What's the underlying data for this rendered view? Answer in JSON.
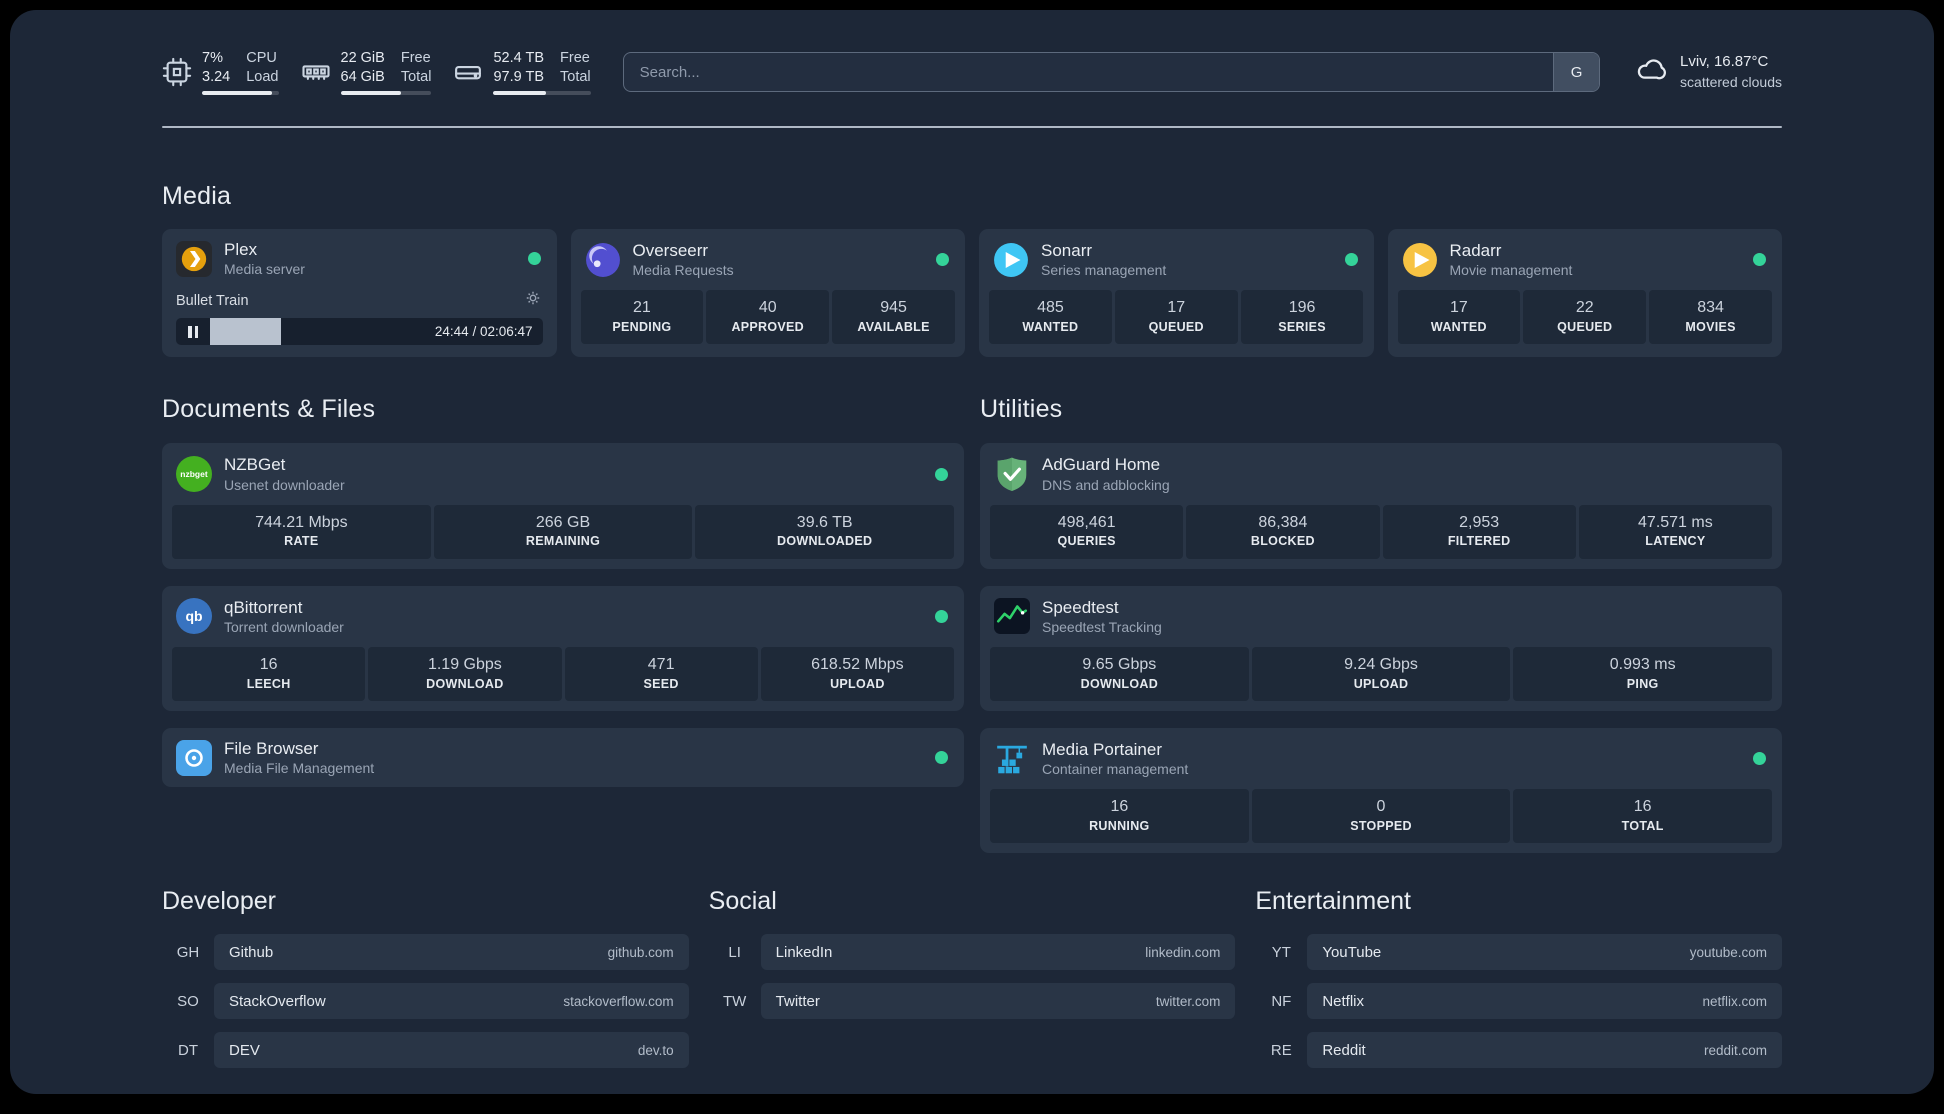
{
  "topbar": {
    "cpu": {
      "value1": "7%",
      "value2": "3.24",
      "label1": "CPU",
      "label2": "Load",
      "bar_pct": 92
    },
    "memory": {
      "value1": "22 GiB",
      "value2": "64 GiB",
      "label1": "Free",
      "label2": "Total",
      "bar_pct": 66
    },
    "disk": {
      "value1": "52.4 TB",
      "value2": "97.9 TB",
      "label1": "Free",
      "label2": "Total",
      "bar_pct": 54
    },
    "search": {
      "placeholder": "Search...",
      "button": "G"
    },
    "weather": {
      "location": "Lviv, 16.87°C",
      "condition": "scattered clouds"
    }
  },
  "sections": {
    "media": "Media",
    "documents": "Documents & Files",
    "utilities": "Utilities"
  },
  "services": {
    "plex": {
      "title": "Plex",
      "subtitle": "Media server",
      "now_playing": "Bullet Train",
      "time": "24:44 / 02:06:47",
      "progress_pct": 19.5
    },
    "overseerr": {
      "title": "Overseerr",
      "subtitle": "Media Requests",
      "stats": [
        {
          "value": "21",
          "label": "PENDING"
        },
        {
          "value": "40",
          "label": "APPROVED"
        },
        {
          "value": "945",
          "label": "AVAILABLE"
        }
      ]
    },
    "sonarr": {
      "title": "Sonarr",
      "subtitle": "Series management",
      "stats": [
        {
          "value": "485",
          "label": "WANTED"
        },
        {
          "value": "17",
          "label": "QUEUED"
        },
        {
          "value": "196",
          "label": "SERIES"
        }
      ]
    },
    "radarr": {
      "title": "Radarr",
      "subtitle": "Movie management",
      "stats": [
        {
          "value": "17",
          "label": "WANTED"
        },
        {
          "value": "22",
          "label": "QUEUED"
        },
        {
          "value": "834",
          "label": "MOVIES"
        }
      ]
    },
    "nzbget": {
      "title": "NZBGet",
      "subtitle": "Usenet downloader",
      "icon_text": "nzbget",
      "stats": [
        {
          "value": "744.21 Mbps",
          "label": "RATE"
        },
        {
          "value": "266 GB",
          "label": "REMAINING"
        },
        {
          "value": "39.6 TB",
          "label": "DOWNLOADED"
        }
      ]
    },
    "qbittorrent": {
      "title": "qBittorrent",
      "subtitle": "Torrent downloader",
      "icon_text": "qb",
      "stats": [
        {
          "value": "16",
          "label": "LEECH"
        },
        {
          "value": "1.19 Gbps",
          "label": "DOWNLOAD"
        },
        {
          "value": "471",
          "label": "SEED"
        },
        {
          "value": "618.52 Mbps",
          "label": "UPLOAD"
        }
      ]
    },
    "filebrowser": {
      "title": "File Browser",
      "subtitle": "Media File Management"
    },
    "adguard": {
      "title": "AdGuard Home",
      "subtitle": "DNS and adblocking",
      "stats": [
        {
          "value": "498,461",
          "label": "QUERIES"
        },
        {
          "value": "86,384",
          "label": "BLOCKED"
        },
        {
          "value": "2,953",
          "label": "FILTERED"
        },
        {
          "value": "47.571 ms",
          "label": "LATENCY"
        }
      ]
    },
    "speedtest": {
      "title": "Speedtest",
      "subtitle": "Speedtest Tracking",
      "stats": [
        {
          "value": "9.65 Gbps",
          "label": "DOWNLOAD"
        },
        {
          "value": "9.24 Gbps",
          "label": "UPLOAD"
        },
        {
          "value": "0.993 ms",
          "label": "PING"
        }
      ]
    },
    "portainer": {
      "title": "Media Portainer",
      "subtitle": "Container management",
      "stats": [
        {
          "value": "16",
          "label": "RUNNING"
        },
        {
          "value": "0",
          "label": "STOPPED"
        },
        {
          "value": "16",
          "label": "TOTAL"
        }
      ]
    }
  },
  "bookmarks": {
    "developer": {
      "title": "Developer",
      "items": [
        {
          "abbr": "GH",
          "name": "Github",
          "domain": "github.com"
        },
        {
          "abbr": "SO",
          "name": "StackOverflow",
          "domain": "stackoverflow.com"
        },
        {
          "abbr": "DT",
          "name": "DEV",
          "domain": "dev.to"
        }
      ]
    },
    "social": {
      "title": "Social",
      "items": [
        {
          "abbr": "LI",
          "name": "LinkedIn",
          "domain": "linkedin.com"
        },
        {
          "abbr": "TW",
          "name": "Twitter",
          "domain": "twitter.com"
        }
      ]
    },
    "entertainment": {
      "title": "Entertainment",
      "items": [
        {
          "abbr": "YT",
          "name": "YouTube",
          "domain": "youtube.com"
        },
        {
          "abbr": "NF",
          "name": "Netflix",
          "domain": "netflix.com"
        },
        {
          "abbr": "RE",
          "name": "Reddit",
          "domain": "reddit.com"
        }
      ]
    }
  },
  "colors": {
    "status_green": "#34d399",
    "plex_amber": "#e5a00d",
    "overseerr_purple": "#524fd0",
    "sonarr_blue": "#3fc6f4",
    "radarr_amber": "#f7c343",
    "nzbget_green": "#44b020",
    "qbittorrent_blue": "#3873c0",
    "filebrowser_blue": "#4aa3e8",
    "adguard_green": "#67b279",
    "speedtest_green": "#2fd26a",
    "portainer_blue": "#2aa9e0"
  }
}
